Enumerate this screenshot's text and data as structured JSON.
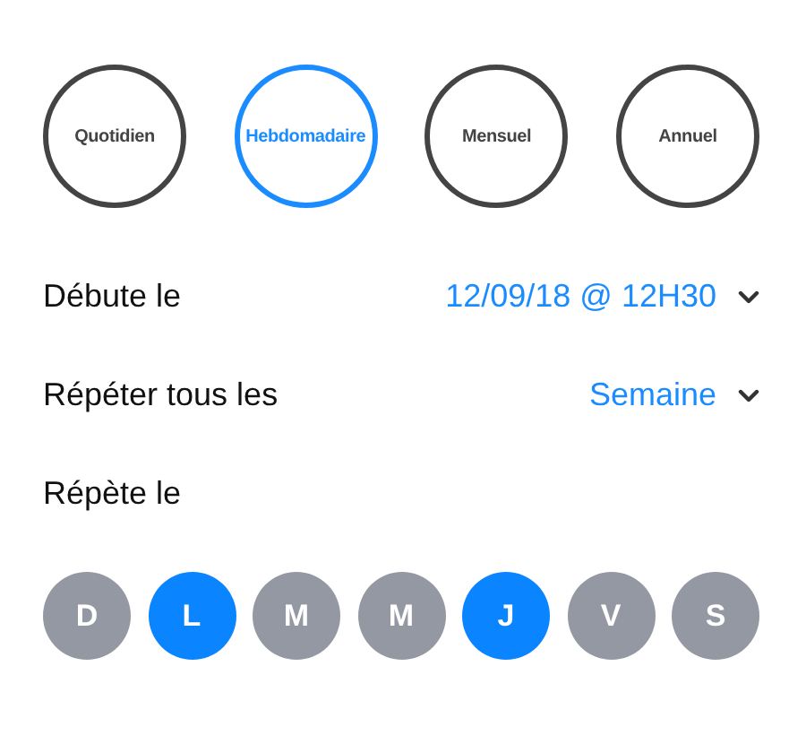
{
  "frequencies": [
    {
      "label": "Quotidien",
      "selected": false
    },
    {
      "label": "Hebdomadaire",
      "selected": true
    },
    {
      "label": "Mensuel",
      "selected": false
    },
    {
      "label": "Annuel",
      "selected": false
    }
  ],
  "settings": [
    {
      "label": "Débute le",
      "value": "12/09/18 @ 12H30"
    },
    {
      "label": "Répéter tous les",
      "value": "Semaine"
    }
  ],
  "repeat_label": "Répète le",
  "days": [
    {
      "label": "D",
      "selected": false
    },
    {
      "label": "L",
      "selected": true
    },
    {
      "label": "M",
      "selected": false
    },
    {
      "label": "M",
      "selected": false
    },
    {
      "label": "J",
      "selected": true
    },
    {
      "label": "V",
      "selected": false
    },
    {
      "label": "S",
      "selected": false
    }
  ]
}
